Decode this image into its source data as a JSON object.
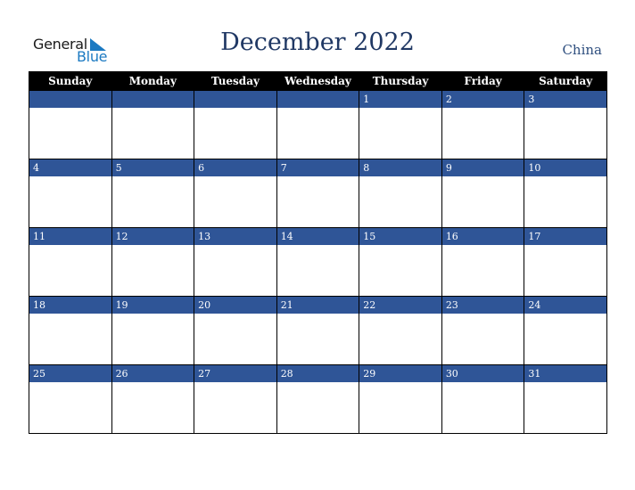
{
  "logo": {
    "line1": "General",
    "line2": "Blue"
  },
  "header": {
    "title": "December 2022",
    "country": "China"
  },
  "colors": {
    "accent": "#2f5597",
    "title": "#203864",
    "header_bg": "#000000",
    "logo_blue": "#1c7ac2"
  },
  "weekdays": [
    "Sunday",
    "Monday",
    "Tuesday",
    "Wednesday",
    "Thursday",
    "Friday",
    "Saturday"
  ],
  "weeks": [
    [
      "",
      "",
      "",
      "",
      "1",
      "2",
      "3"
    ],
    [
      "4",
      "5",
      "6",
      "7",
      "8",
      "9",
      "10"
    ],
    [
      "11",
      "12",
      "13",
      "14",
      "15",
      "16",
      "17"
    ],
    [
      "18",
      "19",
      "20",
      "21",
      "22",
      "23",
      "24"
    ],
    [
      "25",
      "26",
      "27",
      "28",
      "29",
      "30",
      "31"
    ]
  ]
}
